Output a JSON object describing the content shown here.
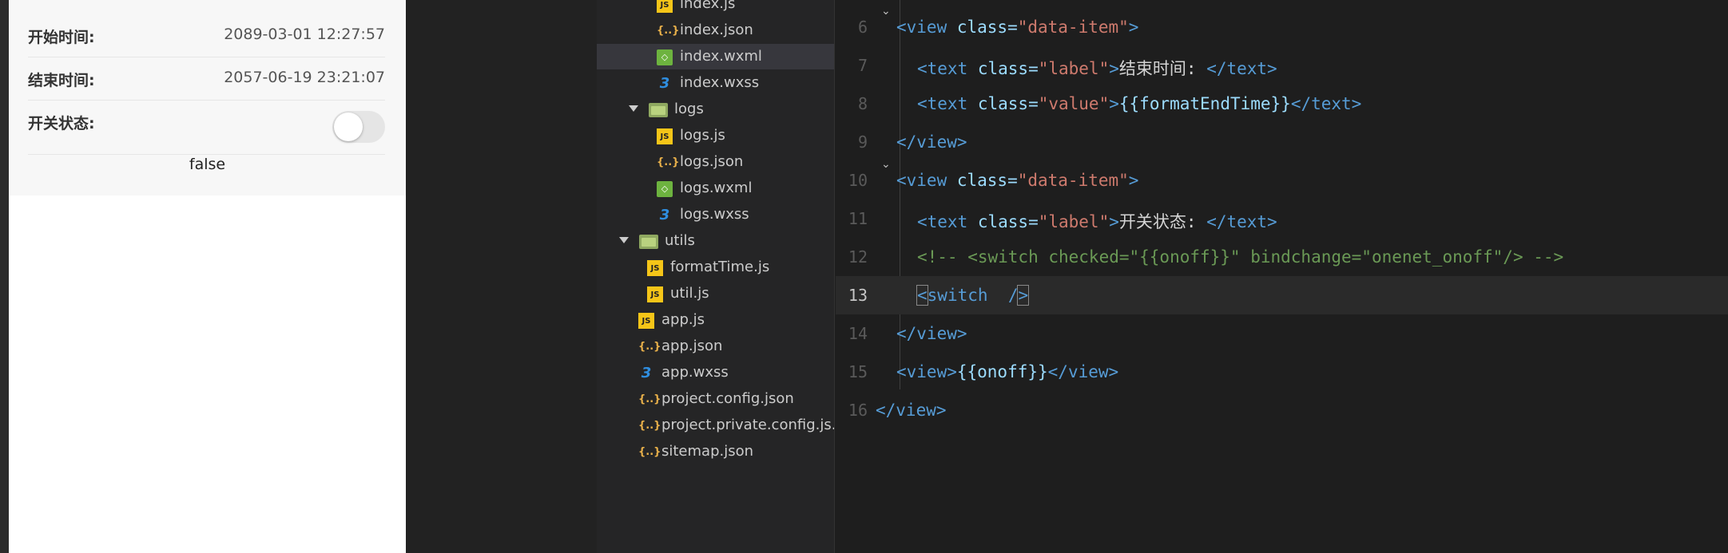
{
  "simulator": {
    "rows": [
      {
        "label": "开始时间:",
        "value": "2089-03-01 12:27:57"
      },
      {
        "label": "结束时间:",
        "value": "2057-06-19 23:21:07"
      },
      {
        "label": "开关状态:",
        "value": ""
      }
    ],
    "switch_checked": false,
    "onoff_text": "false"
  },
  "file_tree": {
    "items": [
      {
        "name": "index.js",
        "icon": "js-file-icon",
        "icon_glyph": "JS"
      },
      {
        "name": "index.json",
        "icon": "json-file-icon",
        "icon_glyph": "{..}"
      },
      {
        "name": "index.wxml",
        "icon": "wxml-file-icon",
        "icon_glyph": "◇",
        "selected": true
      },
      {
        "name": "index.wxss",
        "icon": "wxss-file-icon",
        "icon_glyph": "3"
      },
      {
        "name": "logs",
        "icon": "folder-icon",
        "expanded": true
      },
      {
        "name": "logs.js",
        "icon": "js-file-icon",
        "icon_glyph": "JS"
      },
      {
        "name": "logs.json",
        "icon": "json-file-icon",
        "icon_glyph": "{..}"
      },
      {
        "name": "logs.wxml",
        "icon": "wxml-file-icon",
        "icon_glyph": "◇"
      },
      {
        "name": "logs.wxss",
        "icon": "wxss-file-icon",
        "icon_glyph": "3"
      },
      {
        "name": "utils",
        "icon": "folder-icon",
        "expanded": true
      },
      {
        "name": "formatTime.js",
        "icon": "js-file-icon",
        "icon_glyph": "JS"
      },
      {
        "name": "util.js",
        "icon": "js-file-icon",
        "icon_glyph": "JS"
      },
      {
        "name": "app.js",
        "icon": "js-file-icon",
        "icon_glyph": "JS"
      },
      {
        "name": "app.json",
        "icon": "json-file-icon",
        "icon_glyph": "{..}"
      },
      {
        "name": "app.wxss",
        "icon": "wxss-file-icon",
        "icon_glyph": "3"
      },
      {
        "name": "project.config.json",
        "icon": "json-file-icon",
        "icon_glyph": "{..}"
      },
      {
        "name": "project.private.config.js...",
        "icon": "json-file-icon",
        "icon_glyph": "{..}"
      },
      {
        "name": "sitemap.json",
        "icon": "json-file-icon",
        "icon_glyph": "{..}"
      }
    ]
  },
  "editor": {
    "current_line": 13,
    "lines": [
      {
        "n": "6",
        "fold": true,
        "tokens": [
          [
            "tag",
            "<view "
          ],
          [
            "attr",
            "class="
          ],
          [
            "str",
            "\"data-item\""
          ],
          [
            "tag",
            ">"
          ]
        ]
      },
      {
        "n": "7",
        "tokens": [
          [
            "tag",
            "<text "
          ],
          [
            "attr",
            "class="
          ],
          [
            "str",
            "\"label\""
          ],
          [
            "tag",
            ">"
          ],
          [
            "txt",
            "结束时间: "
          ],
          [
            "tag",
            "</text>"
          ]
        ]
      },
      {
        "n": "8",
        "tokens": [
          [
            "tag",
            "<text "
          ],
          [
            "attr",
            "class="
          ],
          [
            "str",
            "\"value\""
          ],
          [
            "tag",
            ">"
          ],
          [
            "mus",
            "{{formatEndTime}}"
          ],
          [
            "tag",
            "</text>"
          ]
        ]
      },
      {
        "n": "9",
        "tokens": [
          [
            "tag",
            "</view>"
          ]
        ]
      },
      {
        "n": "10",
        "fold": true,
        "tokens": [
          [
            "tag",
            "<view "
          ],
          [
            "attr",
            "class="
          ],
          [
            "str",
            "\"data-item\""
          ],
          [
            "tag",
            ">"
          ]
        ]
      },
      {
        "n": "11",
        "tokens": [
          [
            "tag",
            "<text "
          ],
          [
            "attr",
            "class="
          ],
          [
            "str",
            "\"label\""
          ],
          [
            "tag",
            ">"
          ],
          [
            "txt",
            "开关状态: "
          ],
          [
            "tag",
            "</text>"
          ]
        ]
      },
      {
        "n": "12",
        "tokens": [
          [
            "cmt",
            "<!-- <switch checked=\"{{onoff}}\" bindchange=\"onenet_onoff\"/> -->"
          ]
        ]
      },
      {
        "n": "13",
        "tokens": [
          [
            "tagbox",
            "<"
          ],
          [
            "tag",
            "switch  "
          ],
          [
            "tag",
            "/"
          ],
          [
            "tagbox",
            ">"
          ]
        ]
      },
      {
        "n": "14",
        "tokens": [
          [
            "tag",
            "</view>"
          ]
        ]
      },
      {
        "n": "15",
        "tokens": [
          [
            "tag",
            "<view>"
          ],
          [
            "mus",
            "{{onoff}}"
          ],
          [
            "tag",
            "</view>"
          ]
        ]
      },
      {
        "n": "16",
        "tokens": [
          [
            "tag",
            "</view>"
          ]
        ]
      }
    ]
  }
}
